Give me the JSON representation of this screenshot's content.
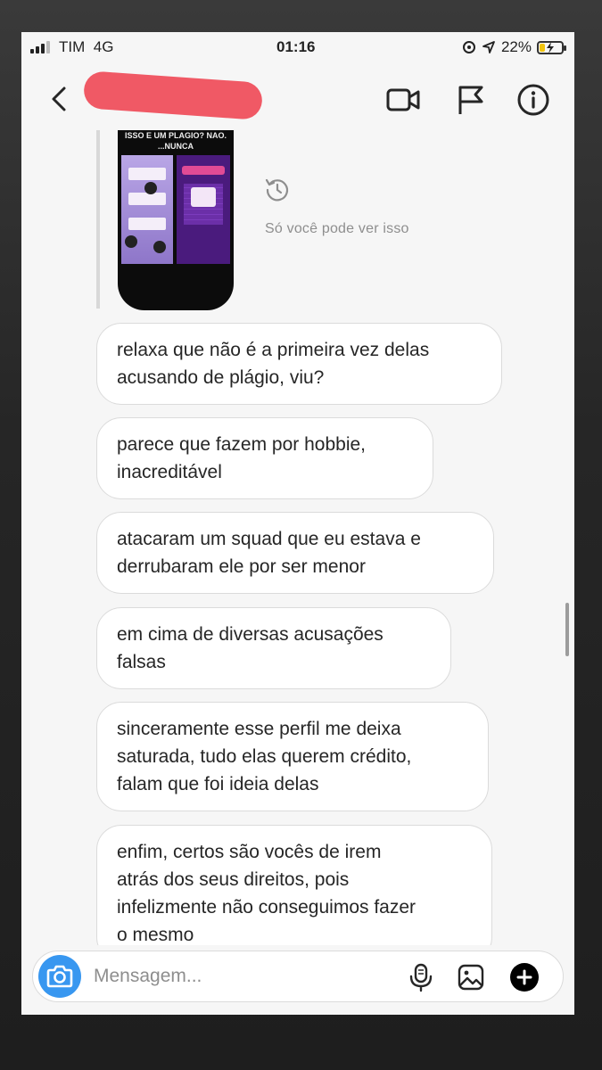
{
  "status_bar": {
    "carrier": "TIM",
    "network": "4G",
    "time": "01:16",
    "battery": "22%",
    "battery_level": 0.22
  },
  "header": {
    "icons": [
      "back-icon",
      "video-call-icon",
      "report-flag-icon",
      "info-icon"
    ]
  },
  "story_reply": {
    "thumbnail_caption": "ISSO E UM PLAGIO? NAO.\n...NUNCA",
    "status_text": "Só você pode ver isso"
  },
  "messages": [
    "relaxa que não é a primeira vez delas\nacusando de plágio, viu?",
    "parece que fazem por hobbie,\ninacreditável",
    "atacaram um squad que eu estava e\nderrubaram ele por ser menor",
    "em cima de diversas acusações\nfalsas",
    "sinceramente esse perfil me deixa\nsaturada, tudo elas querem crédito,\nfalam que foi ideia delas",
    "enfim, certos são vocês de irem\natrás dos seus direitos, pois\ninfelizmente não conseguimos fazer\no mesmo"
  ],
  "composer": {
    "placeholder": "Mensagem...",
    "icons": [
      "camera-icon",
      "microphone-icon",
      "gallery-icon",
      "add-icon"
    ]
  },
  "colors": {
    "accent": "#3897f0",
    "bubble_border": "#dbdbdb",
    "battery_charging": "#f1c40f",
    "redaction": "#ef4b58"
  }
}
